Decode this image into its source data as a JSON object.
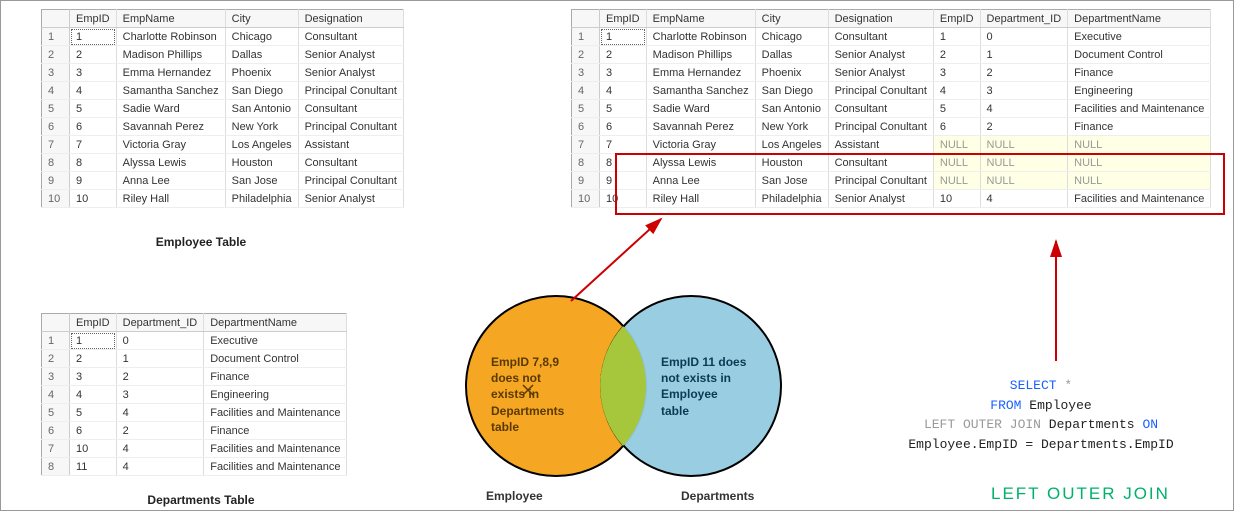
{
  "employee_table": {
    "caption": "Employee Table",
    "headers": [
      "EmpID",
      "EmpName",
      "City",
      "Designation"
    ],
    "rows": [
      [
        "1",
        "Charlotte Robinson",
        "Chicago",
        "Consultant"
      ],
      [
        "2",
        "Madison Phillips",
        "Dallas",
        "Senior Analyst"
      ],
      [
        "3",
        "Emma Hernandez",
        "Phoenix",
        "Senior Analyst"
      ],
      [
        "4",
        "Samantha Sanchez",
        "San Diego",
        "Principal Conultant"
      ],
      [
        "5",
        "Sadie Ward",
        "San Antonio",
        "Consultant"
      ],
      [
        "6",
        "Savannah Perez",
        "New York",
        "Principal Conultant"
      ],
      [
        "7",
        "Victoria Gray",
        "Los Angeles",
        "Assistant"
      ],
      [
        "8",
        "Alyssa Lewis",
        "Houston",
        "Consultant"
      ],
      [
        "9",
        "Anna Lee",
        "San Jose",
        "Principal Conultant"
      ],
      [
        "10",
        "Riley Hall",
        "Philadelphia",
        "Senior Analyst"
      ]
    ]
  },
  "departments_table": {
    "caption": "Departments Table",
    "headers": [
      "EmpID",
      "Department_ID",
      "DepartmentName"
    ],
    "rows": [
      [
        "1",
        "0",
        "Executive"
      ],
      [
        "2",
        "1",
        "Document Control"
      ],
      [
        "3",
        "2",
        "Finance"
      ],
      [
        "4",
        "3",
        "Engineering"
      ],
      [
        "5",
        "4",
        "Facilities and Maintenance"
      ],
      [
        "6",
        "2",
        "Finance"
      ],
      [
        "10",
        "4",
        "Facilities and Maintenance"
      ],
      [
        "11",
        "4",
        "Facilities and Maintenance"
      ]
    ]
  },
  "result_table": {
    "headers": [
      "EmpID",
      "EmpName",
      "City",
      "Designation",
      "EmpID",
      "Department_ID",
      "DepartmentName"
    ],
    "rows": [
      {
        "r": [
          "1",
          "Charlotte Robinson",
          "Chicago",
          "Consultant",
          "1",
          "0",
          "Executive"
        ],
        "null": []
      },
      {
        "r": [
          "2",
          "Madison Phillips",
          "Dallas",
          "Senior Analyst",
          "2",
          "1",
          "Document Control"
        ],
        "null": []
      },
      {
        "r": [
          "3",
          "Emma Hernandez",
          "Phoenix",
          "Senior Analyst",
          "3",
          "2",
          "Finance"
        ],
        "null": []
      },
      {
        "r": [
          "4",
          "Samantha Sanchez",
          "San Diego",
          "Principal Conultant",
          "4",
          "3",
          "Engineering"
        ],
        "null": []
      },
      {
        "r": [
          "5",
          "Sadie Ward",
          "San Antonio",
          "Consultant",
          "5",
          "4",
          "Facilities and Maintenance"
        ],
        "null": []
      },
      {
        "r": [
          "6",
          "Savannah Perez",
          "New York",
          "Principal Conultant",
          "6",
          "2",
          "Finance"
        ],
        "null": []
      },
      {
        "r": [
          "7",
          "Victoria Gray",
          "Los Angeles",
          "Assistant",
          "NULL",
          "NULL",
          "NULL"
        ],
        "null": [
          4,
          5,
          6
        ]
      },
      {
        "r": [
          "8",
          "Alyssa Lewis",
          "Houston",
          "Consultant",
          "NULL",
          "NULL",
          "NULL"
        ],
        "null": [
          4,
          5,
          6
        ]
      },
      {
        "r": [
          "9",
          "Anna Lee",
          "San Jose",
          "Principal Conultant",
          "NULL",
          "NULL",
          "NULL"
        ],
        "null": [
          4,
          5,
          6
        ]
      },
      {
        "r": [
          "10",
          "Riley Hall",
          "Philadelphia",
          "Senior Analyst",
          "10",
          "4",
          "Facilities and Maintenance"
        ],
        "null": []
      }
    ]
  },
  "venn": {
    "left_label": "Employee",
    "right_label": "Departments",
    "left_text_line1": "EmpID 7,8,9",
    "left_text_line2": "does not",
    "left_text_line3": "exists in",
    "left_text_line4": "Departments",
    "left_text_line5": "table",
    "right_text_line1": "EmpID 11 does",
    "right_text_line2": "not exists in",
    "right_text_line3": "Employee",
    "right_text_line4": "table"
  },
  "sql": {
    "select": "SELECT",
    "star": "*",
    "from": "FROM",
    "t1": "Employee",
    "loj": "LEFT OUTER JOIN",
    "t2": "Departments",
    "on": "ON",
    "cond": "Employee.EmpID = Departments.EmpID"
  },
  "join_title": "LEFT OUTER JOIN"
}
